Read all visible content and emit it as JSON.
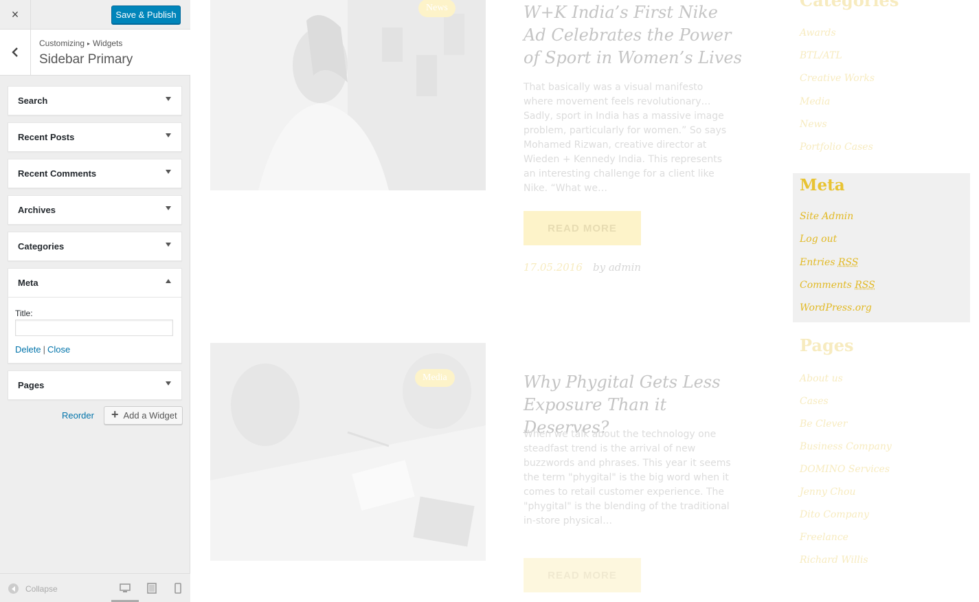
{
  "header": {
    "close_label": "×",
    "save_label": "Save & Publish"
  },
  "section": {
    "breadcrumb_1": "Customizing",
    "breadcrumb_sep": "▸",
    "breadcrumb_2": "Widgets",
    "title": "Sidebar Primary",
    "back_label": "‹"
  },
  "widgets": [
    {
      "label": "Search"
    },
    {
      "label": "Recent Posts"
    },
    {
      "label": "Recent Comments"
    },
    {
      "label": "Archives"
    },
    {
      "label": "Categories"
    },
    {
      "label": "Meta",
      "expanded": true,
      "field_label": "Title:",
      "field_value": "",
      "delete_label": "Delete",
      "pipe": "|",
      "close_label": "Close"
    },
    {
      "label": "Pages"
    }
  ],
  "actions": {
    "reorder_label": "Reorder",
    "add_widget_label": "Add a Widget"
  },
  "footer": {
    "collapse_label": "Collapse",
    "devices": [
      "desktop-icon",
      "tablet-icon",
      "mobile-icon"
    ],
    "active_device": "desktop"
  },
  "preview": {
    "posts": [
      {
        "tag": "News",
        "title": "W+K India’s First Nike Ad Celebrates the Power of Sport in Women’s Lives",
        "excerpt": "That basically was a visual manifesto where movement feels revolutionary… Sadly, sport in India has a massive image problem, particularly for women.” So says Mohamed Rizwan, creative director at Wieden + Kennedy India. This represents an interesting challenge for a client like Nike. “What we…",
        "read_more": "READ MORE",
        "date": "17.05.2016",
        "author": "by admin"
      },
      {
        "tag": "Media",
        "title": "Why Phygital Gets Less Exposure Than it Deserves?",
        "excerpt": "When we talk about the technology one steadfast trend is the arrival of new buzzwords and phrases. This year it seems the term \"phygital\" is the big word when it comes to retail customer experience. The \"phygital\" is the blending of the traditional in-store physical…",
        "read_more": "READ MORE"
      }
    ],
    "sidebar": {
      "categories_title": "Categories",
      "categories": [
        "Awards",
        "BTL/ATL",
        "Creative Works",
        "Media",
        "News",
        "Portfolio Cases"
      ],
      "meta_title": "Meta",
      "meta_links": [
        "Site Admin",
        "Log out",
        "Entries",
        "Comments",
        "WordPress.org"
      ],
      "rss_label": "RSS",
      "pages_title": "Pages",
      "pages": [
        "About us",
        "Cases",
        "Be Clever",
        "Business Company",
        "DOMINO Services",
        "Jenny Chou",
        "Dito Company",
        "Freelance",
        "Richard Willis"
      ]
    }
  },
  "colors": {
    "primary_button": "#0085ba",
    "link": "#0073aa",
    "accent_yellow": "#e2b923",
    "panel_bg": "#eeeeee"
  }
}
